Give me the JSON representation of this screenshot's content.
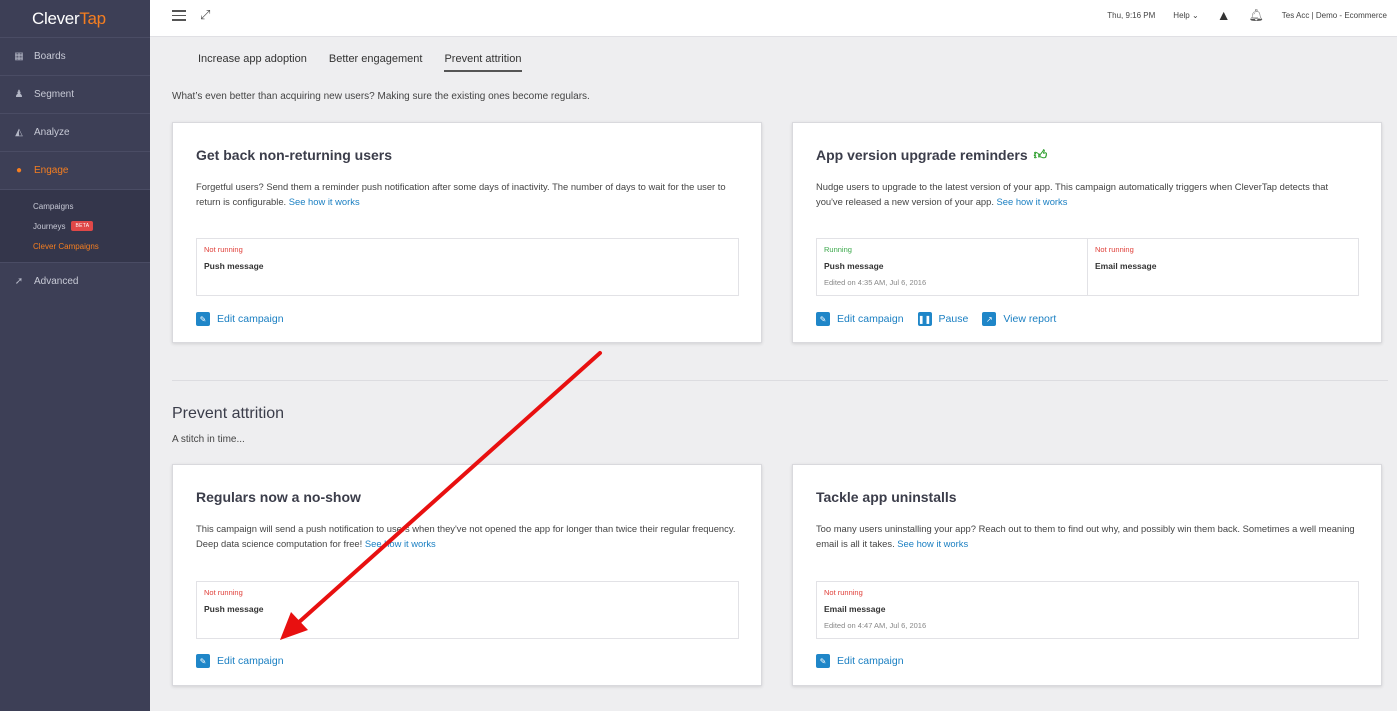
{
  "brand": {
    "name_a": "Clever",
    "name_b": "Tap"
  },
  "colors": {
    "accent": "#f57e20",
    "link": "#1a7fc2",
    "sidebar": "#3d3f56",
    "running": "#3aa84a",
    "not_running": "#e0403a",
    "annotation_arrow": "#e81010"
  },
  "sidebar": {
    "items": [
      {
        "label": "Boards",
        "icon": "boards-icon"
      },
      {
        "label": "Segment",
        "icon": "segment-icon"
      },
      {
        "label": "Analyze",
        "icon": "analyze-icon"
      },
      {
        "label": "Engage",
        "icon": "engage-icon",
        "active": true
      },
      {
        "label": "Advanced",
        "icon": "rocket-icon"
      }
    ],
    "engage_sub": [
      {
        "label": "Campaigns"
      },
      {
        "label": "Journeys",
        "badge": "BETA"
      },
      {
        "label": "Clever Campaigns",
        "active": true
      }
    ]
  },
  "topbar": {
    "time": "Thu, 9:16 PM",
    "help": "Help",
    "account": "Tes Acc | Demo - Ecommerce"
  },
  "tabs": [
    {
      "label": "Increase app adoption"
    },
    {
      "label": "Better engagement"
    },
    {
      "label": "Prevent attrition",
      "active": true
    }
  ],
  "intro": "What’s even better than acquiring new users? Making sure the existing ones become regulars.",
  "section": {
    "title": "Prevent attrition",
    "subtitle": "A stitch in time..."
  },
  "link_text": "See how it works",
  "cards": [
    {
      "title": "Get back non-returning users",
      "desc": "Forgetful users? Send them a reminder push notification after some days of inactivity. The number of days to wait for the user to return is configurable.",
      "status": [
        {
          "state": "Not running",
          "channel": "Push message",
          "edited": ""
        }
      ],
      "actions": [
        "Edit campaign"
      ]
    },
    {
      "title": "App version upgrade reminders",
      "desc": "Nudge users to upgrade to the latest version of your app. This campaign automatically triggers when CleverTap detects that you've released a new version of your app.",
      "status": [
        {
          "state": "Running",
          "channel": "Push message",
          "edited": "Edited on 4:35 AM, Jul 6, 2016"
        },
        {
          "state": "Not running",
          "channel": "Email message",
          "edited": ""
        }
      ],
      "actions": [
        "Edit campaign",
        "Pause",
        "View report"
      ]
    },
    {
      "title": "Regulars now a no-show",
      "desc": "This campaign will send a push notification to users when they've not opened the app for longer than twice their regular frequency. Deep data science computation for free!",
      "status": [
        {
          "state": "Not running",
          "channel": "Push message",
          "edited": ""
        }
      ],
      "actions": [
        "Edit campaign"
      ]
    },
    {
      "title": "Tackle app uninstalls",
      "desc": "Too many users uninstalling your app? Reach out to them to find out why, and possibly win them back. Sometimes a well meaning email is all it takes.",
      "status": [
        {
          "state": "Not running",
          "channel": "Email message",
          "edited": "Edited on 4:47 AM, Jul 6, 2016"
        }
      ],
      "actions": [
        "Edit campaign"
      ]
    }
  ]
}
